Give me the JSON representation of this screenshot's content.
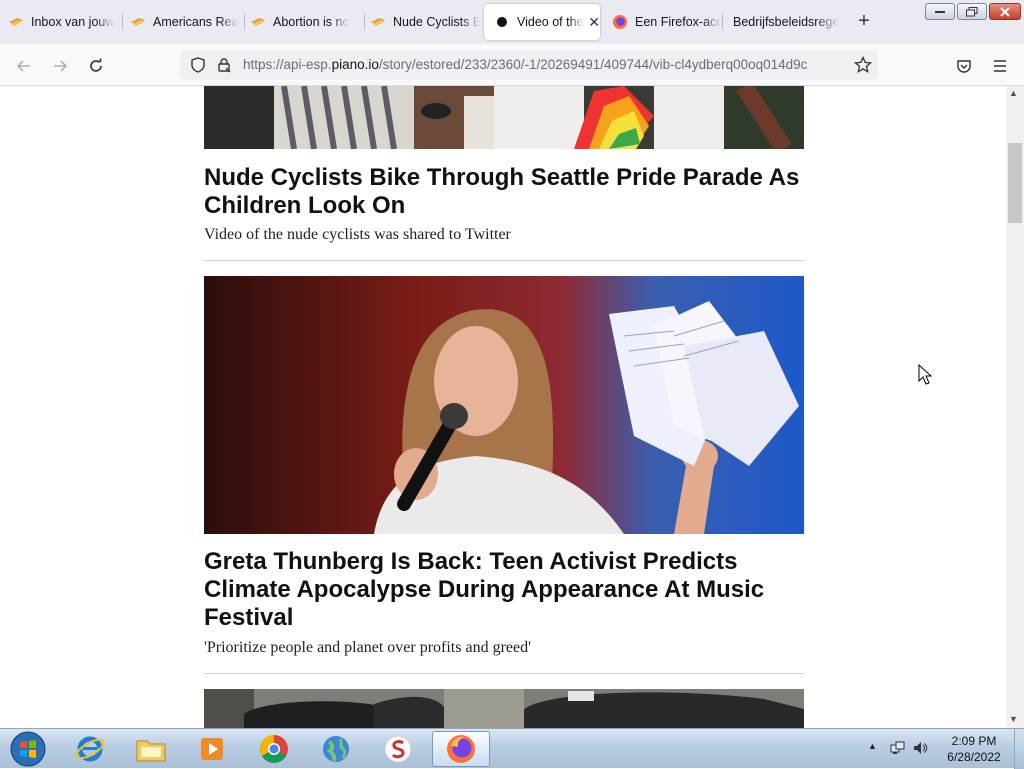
{
  "browser": {
    "tabs": [
      {
        "title": "Inbox van jouw",
        "icon": "mail-icon",
        "active": false
      },
      {
        "title": "Americans Rea",
        "icon": "news-icon",
        "active": false
      },
      {
        "title": "Abortion is no",
        "icon": "news-icon",
        "active": false
      },
      {
        "title": "Nude Cyclists B",
        "icon": "news-icon",
        "active": false
      },
      {
        "title": "Video of the n",
        "icon": "media-dot-icon",
        "active": true
      },
      {
        "title": "Een Firefox-acc",
        "icon": "firefox-icon",
        "active": false
      },
      {
        "title": "Bedrijfsbeleidsrege",
        "icon": "",
        "active": false
      }
    ],
    "url_prefix": "https://api-esp.",
    "url_domain": "piano.io",
    "url_path": "/story/estored/233/2360/-1/20269491/409744/vib-cl4ydberq00oq014d9c"
  },
  "articles": [
    {
      "headline": "Nude Cyclists Bike Through Seattle Pride Parade As Children Look On",
      "subhead": "Video of the nude cyclists was shared to Twitter"
    },
    {
      "headline": "Greta Thunberg Is Back: Teen Activist Predicts Climate Apocalypse During Appearance At Music Festival",
      "subhead": "'Prioritize people and planet over profits and greed'"
    }
  ],
  "taskbar": {
    "time": "2:09 PM",
    "date": "6/28/2022"
  },
  "colors": {
    "tabbar": "#e9eaf2",
    "accent_blue": "#0060df",
    "taskbar": "#b9cde2"
  }
}
